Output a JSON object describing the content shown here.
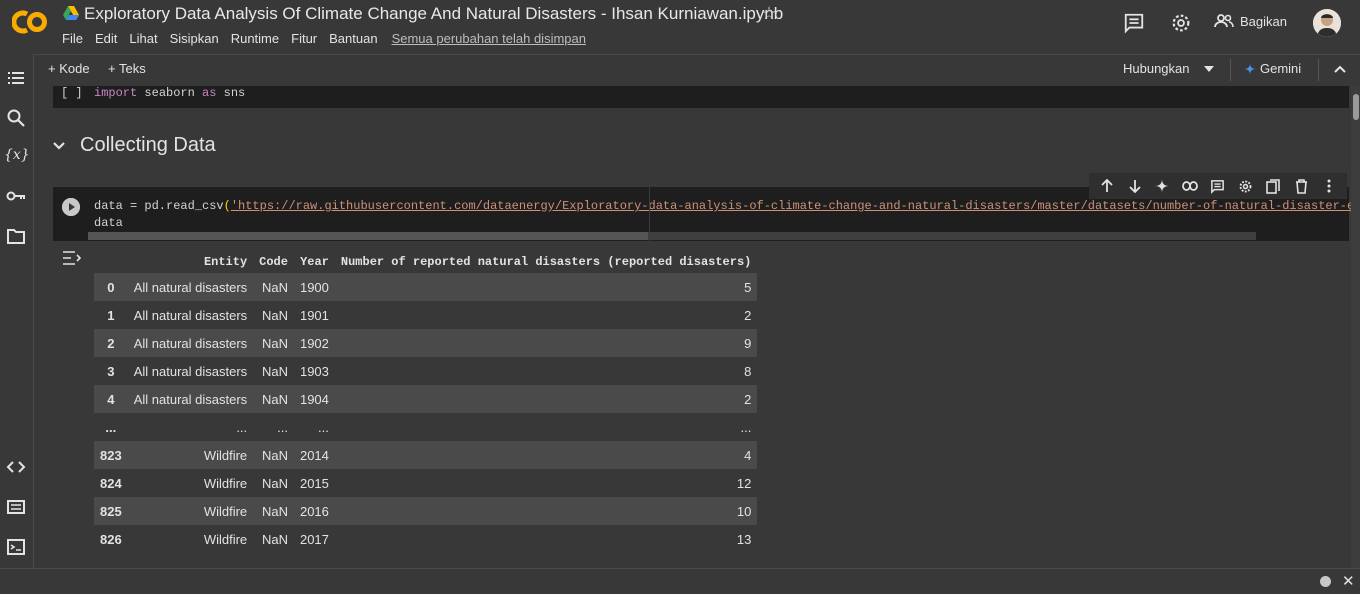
{
  "app": {
    "title": "Exploratory Data Analysis Of Climate Change And Natural Disasters - Ihsan Kurniawan.ipynb",
    "menu": [
      "File",
      "Edit",
      "Lihat",
      "Sisipkan",
      "Runtime",
      "Fitur",
      "Bantuan"
    ],
    "saved_status": "Semua perubahan telah disimpan",
    "share_label": "Bagikan",
    "brand_color": "#f9ab00"
  },
  "toolbar": {
    "add_code": "+ Kode",
    "add_text": "+ Teks",
    "connect": "Hubungkan",
    "gemini": "Gemini"
  },
  "cells": {
    "import_cell": {
      "bracket": "[ ]",
      "keyword_import": "import",
      "module": " seaborn ",
      "keyword_as": "as",
      "alias": " sns"
    },
    "section_heading": "Collecting Data",
    "read_cell": {
      "line1_prefix": "data = pd.read_csv",
      "line1_paren": "(",
      "line1_url": "'https://raw.githubusercontent.com/dataenergy/Exploratory-data-analysis-of-climate-change-and-natural-disasters/master/datasets/number-of-natural-disaster-events.",
      "line2": "data"
    }
  },
  "dataframe": {
    "columns": [
      "",
      "Entity",
      "Code",
      "Year",
      "Number of reported natural disasters (reported disasters)"
    ],
    "rows": [
      [
        "0",
        "All natural disasters",
        "NaN",
        "1900",
        "5"
      ],
      [
        "1",
        "All natural disasters",
        "NaN",
        "1901",
        "2"
      ],
      [
        "2",
        "All natural disasters",
        "NaN",
        "1902",
        "9"
      ],
      [
        "3",
        "All natural disasters",
        "NaN",
        "1903",
        "8"
      ],
      [
        "4",
        "All natural disasters",
        "NaN",
        "1904",
        "2"
      ],
      [
        "...",
        "...",
        "...",
        "...",
        "..."
      ],
      [
        "823",
        "Wildfire",
        "NaN",
        "2014",
        "4"
      ],
      [
        "824",
        "Wildfire",
        "NaN",
        "2015",
        "12"
      ],
      [
        "825",
        "Wildfire",
        "NaN",
        "2016",
        "10"
      ],
      [
        "826",
        "Wildfire",
        "NaN",
        "2017",
        "13"
      ]
    ]
  },
  "icons": {
    "header": [
      "comment-icon",
      "settings-icon",
      "people-icon"
    ],
    "rail": [
      "toc-icon",
      "search-icon",
      "variables-icon",
      "key-icon",
      "folder-icon",
      "code-icon",
      "snippets-icon",
      "terminal-icon"
    ],
    "cell_toolbar": [
      "move-up-icon",
      "move-down-icon",
      "sparkle-icon",
      "link-icon",
      "comment-icon",
      "settings-icon",
      "mirror-icon",
      "delete-icon",
      "more-icon"
    ]
  }
}
